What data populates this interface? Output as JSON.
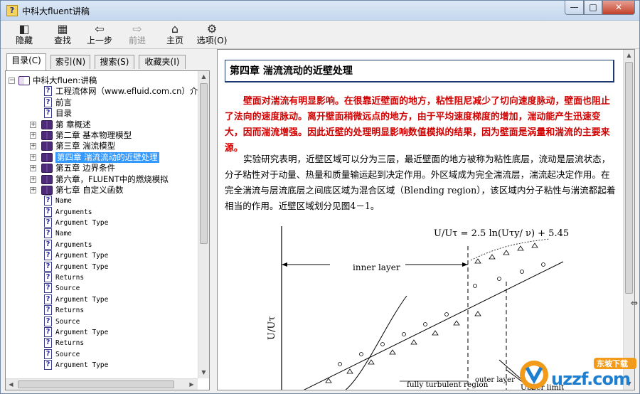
{
  "window": {
    "title": "中科大fluent讲稿",
    "icon": "help-book-icon",
    "controls": {
      "minimize": "—",
      "maximize": "□",
      "close": "✕"
    }
  },
  "toolbar": {
    "buttons": [
      {
        "label": "隐藏",
        "icon": "hide-pane-icon",
        "glyph": "◧",
        "enabled": true
      },
      {
        "label": "查找",
        "icon": "locate-icon",
        "glyph": "▦",
        "enabled": true
      },
      {
        "label": "上一步",
        "icon": "back-arrow-icon",
        "glyph": "⇦",
        "enabled": true
      },
      {
        "label": "前进",
        "icon": "forward-arrow-icon",
        "glyph": "⇨",
        "enabled": false
      },
      {
        "label": "主页",
        "icon": "home-icon",
        "glyph": "⌂",
        "enabled": true
      },
      {
        "label": "选项(O)",
        "icon": "options-icon",
        "glyph": "⚙",
        "enabled": true
      }
    ]
  },
  "nav_tabs": [
    {
      "label": "目录(C)",
      "active": true
    },
    {
      "label": "索引(N)",
      "active": false
    },
    {
      "label": "搜索(S)",
      "active": false
    },
    {
      "label": "收藏夹(I)",
      "active": false
    }
  ],
  "tree": [
    {
      "label": "中科大fluen:讲稿",
      "level": 0,
      "type": "book-open",
      "expander": "−"
    },
    {
      "label": "工程流体网（www.efluid.com.cn）介",
      "level": 1,
      "type": "page"
    },
    {
      "label": "前言",
      "level": 1,
      "type": "page"
    },
    {
      "label": "目录",
      "level": 1,
      "type": "page"
    },
    {
      "label": "第   章概述",
      "level": 1,
      "type": "book",
      "expander": "+"
    },
    {
      "label": "第二章 基本物理模型",
      "level": 1,
      "type": "book",
      "expander": "+"
    },
    {
      "label": "第三章 湍流模型",
      "level": 1,
      "type": "book",
      "expander": "+"
    },
    {
      "label": "第四章 湍流流动的近壁处理",
      "level": 1,
      "type": "book",
      "expander": "+",
      "selected": true
    },
    {
      "label": "第五章 边界条件",
      "level": 1,
      "type": "book",
      "expander": "+"
    },
    {
      "label": "第六章，FLUENT中的燃烧模拟",
      "level": 1,
      "type": "book",
      "expander": "+"
    },
    {
      "label": "第七章 自定义函数",
      "level": 1,
      "type": "book",
      "expander": "+"
    },
    {
      "label": "Name",
      "level": 1,
      "type": "page",
      "mono": true
    },
    {
      "label": "Arguments",
      "level": 1,
      "type": "page",
      "mono": true
    },
    {
      "label": "Argument Type",
      "level": 1,
      "type": "page",
      "mono": true
    },
    {
      "label": "Name",
      "level": 1,
      "type": "page",
      "mono": true
    },
    {
      "label": "Arguments",
      "level": 1,
      "type": "page",
      "mono": true
    },
    {
      "label": "Argument Type",
      "level": 1,
      "type": "page",
      "mono": true
    },
    {
      "label": "Argument Type",
      "level": 1,
      "type": "page",
      "mono": true
    },
    {
      "label": "Returns",
      "level": 1,
      "type": "page",
      "mono": true
    },
    {
      "label": "Source",
      "level": 1,
      "type": "page",
      "mono": true
    },
    {
      "label": "Argument Type",
      "level": 1,
      "type": "page",
      "mono": true
    },
    {
      "label": "Returns",
      "level": 1,
      "type": "page",
      "mono": true
    },
    {
      "label": "Source",
      "level": 1,
      "type": "page",
      "mono": true
    },
    {
      "label": "Argument Type",
      "level": 1,
      "type": "page",
      "mono": true
    },
    {
      "label": "Returns",
      "level": 1,
      "type": "page",
      "mono": true
    },
    {
      "label": "Source",
      "level": 1,
      "type": "page",
      "mono": true
    },
    {
      "label": "Argument Type",
      "level": 1,
      "type": "page",
      "mono": true
    }
  ],
  "content": {
    "heading": "第四章  湍流流动的近壁处理",
    "para_red": "壁面对湍流有明显影响。在很靠近壁面的地方，粘性阻尼减少了切向速度脉动，壁面也阻止了法向的速度脉动。离开壁面稍微远点的地方，由于平均速度梯度的增加，湍动能产生迅速变大，因而湍流增强。因此近壁的处理明显影响数值模拟的结果，因为壁面是涡量和湍流的主要来源。",
    "para_black": "实验研究表明，近壁区域可以分为三层，最近壁面的地方被称为粘性底层，流动是层流状态，分子粘性对于动量、热量和质量输运起到决定作用。外区域成为完全湍流层，湍流起决定作用。在完全湍流与层流底层之间底区域为混合区域（Blending region），该区域内分子粘性与湍流都起着相当的作用。近壁区域划分见图4－1。",
    "figure": {
      "equation": "U/Uτ  =   2.5 ln(Uτy/ ν) + 5.45",
      "ylabel": "U/Uτ",
      "inner_layer": "inner layer",
      "outer_layer": "outer layer",
      "fully_turbulent": "fully turbulent region",
      "upper_limit": "Upper limit"
    }
  },
  "watermark": {
    "brand": "uzzf.com",
    "tagline": "东坡下载"
  }
}
